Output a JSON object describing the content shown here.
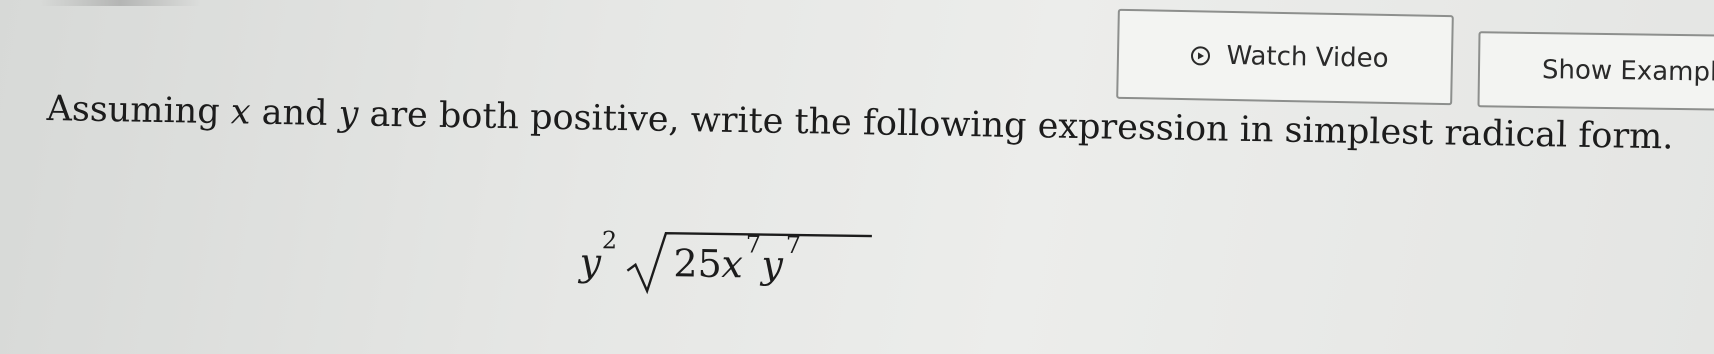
{
  "toolbar": {
    "watch_video_label": "Watch Video",
    "show_example_label": "Show Exampl",
    "watch_video_icon": "play-circle-icon"
  },
  "question": {
    "text_before_x": "Assuming ",
    "var_x": "x",
    "text_and": " and ",
    "var_y": "y",
    "text_after": " are both positive, write the following expression in simplest radical form."
  },
  "expression": {
    "coefficient_var": "y",
    "coefficient_exp": "2",
    "radicand_number": "25",
    "radicand_var1": "x",
    "radicand_exp1": "7",
    "radicand_var2": "y",
    "radicand_exp2": "7"
  },
  "colors": {
    "button_border": "#8d8f8d",
    "button_bg": "#f3f4f2",
    "text": "#1c1c1c"
  }
}
